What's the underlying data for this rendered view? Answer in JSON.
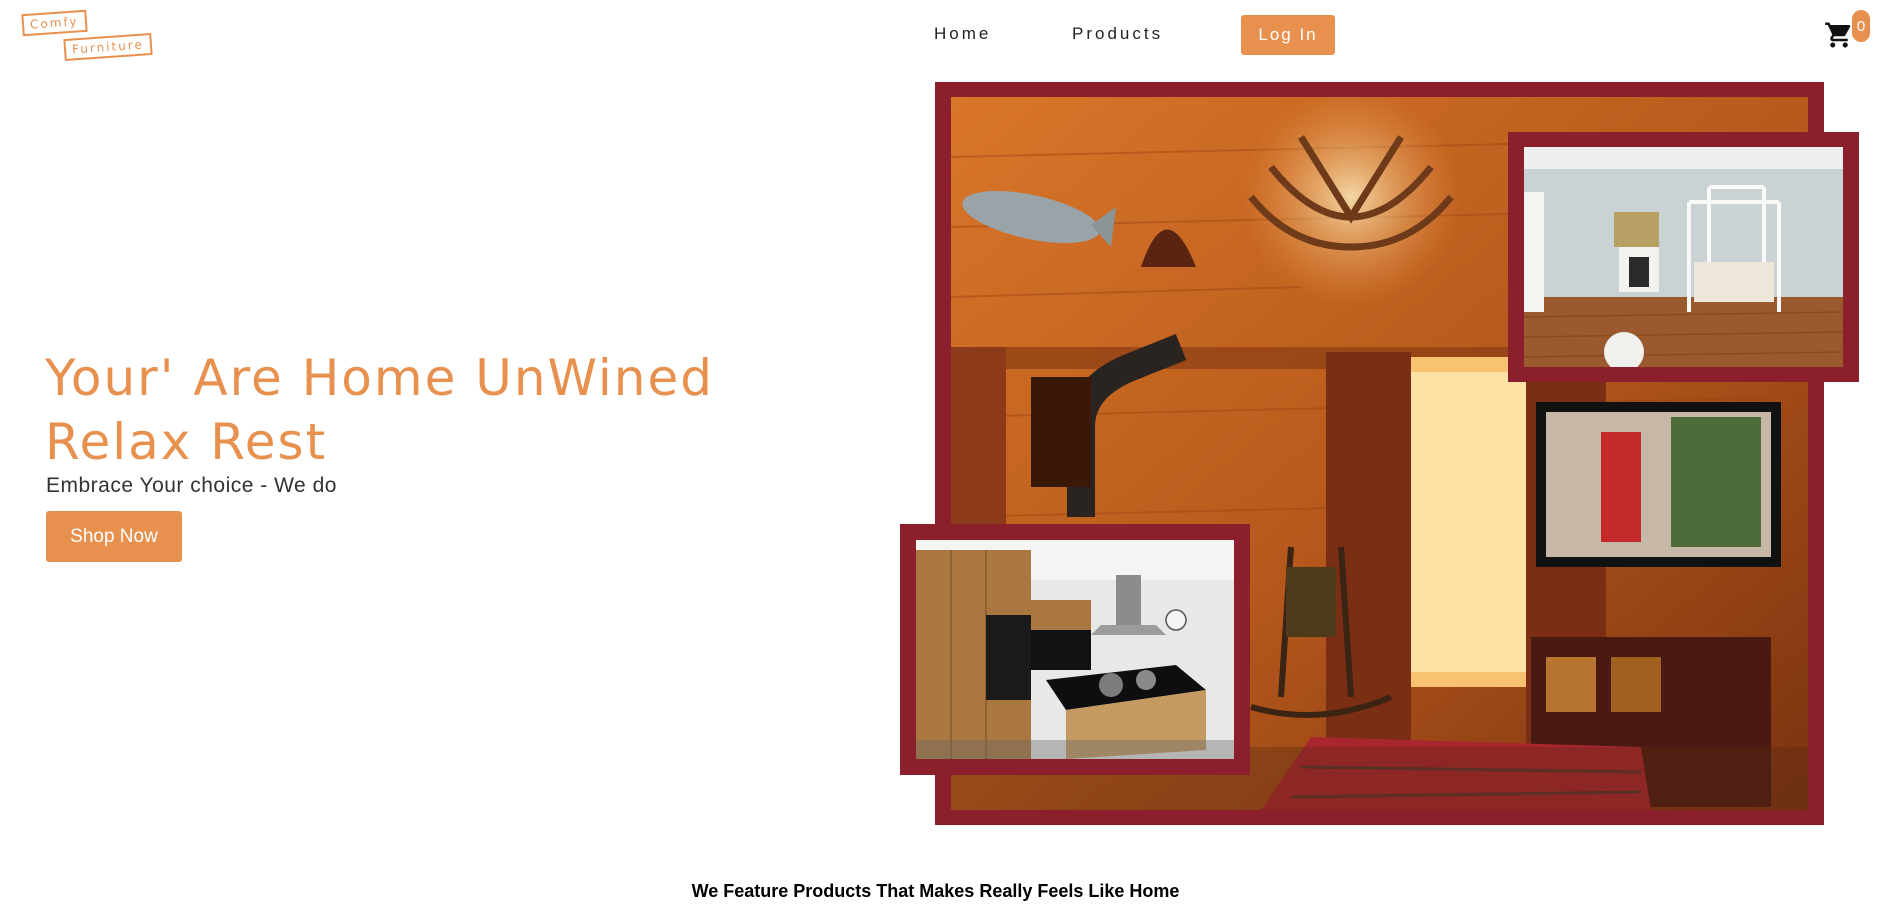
{
  "brand": {
    "logo_line1": "Comfy",
    "logo_line2": "Furniture",
    "accent_color": "#e8914f",
    "frame_color": "#8b1f2b"
  },
  "nav": {
    "home_label": "Home",
    "products_label": "Products",
    "login_label": "Log In",
    "cart_count": "0",
    "cart_icon": "shopping-cart-icon"
  },
  "hero": {
    "title": "Your' Are Home UnWined Relax Rest",
    "subtitle": "Embrace Your choice - We do",
    "cta_label": "Shop Now"
  },
  "section": {
    "heading": "We Feature Products That Makes Really Feels Like Home"
  }
}
